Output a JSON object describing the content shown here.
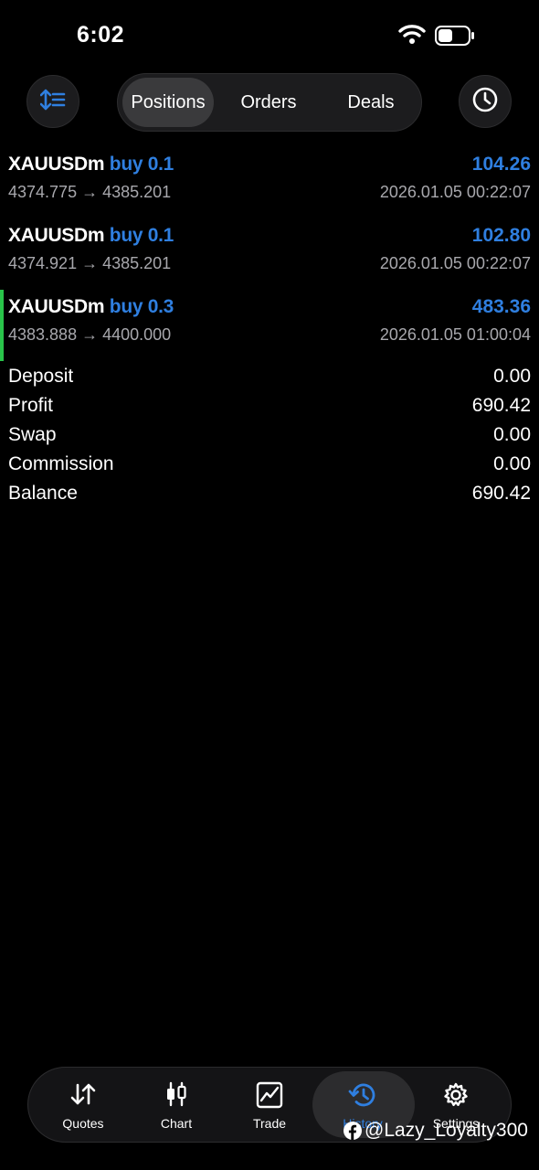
{
  "status": {
    "time": "6:02"
  },
  "tabs": [
    {
      "label": "Positions",
      "active": true
    },
    {
      "label": "Orders",
      "active": false
    },
    {
      "label": "Deals",
      "active": false
    }
  ],
  "deals": [
    {
      "symbol": "XAUUSDm",
      "side": "buy 0.1",
      "profit": "104.26",
      "prices": "4374.775 → 4385.201",
      "time": "2026.01.05 00:22:07"
    },
    {
      "symbol": "XAUUSDm",
      "side": "buy 0.1",
      "profit": "102.80",
      "prices": "4374.921 → 4385.201",
      "time": "2026.01.05 00:22:07"
    },
    {
      "symbol": "XAUUSDm",
      "side": "buy 0.3",
      "profit": "483.36",
      "prices": "4383.888 → 4400.000",
      "time": "2026.01.05 01:00:04"
    }
  ],
  "summary": [
    {
      "label": "Deposit",
      "value": "0.00"
    },
    {
      "label": "Profit",
      "value": "690.42"
    },
    {
      "label": "Swap",
      "value": "0.00"
    },
    {
      "label": "Commission",
      "value": "0.00"
    },
    {
      "label": "Balance",
      "value": "690.42"
    }
  ],
  "nav": [
    {
      "label": "Quotes",
      "icon": "quotes-arrows-icon"
    },
    {
      "label": "Chart",
      "icon": "candlestick-icon"
    },
    {
      "label": "Trade",
      "icon": "trade-chart-icon"
    },
    {
      "label": "History",
      "icon": "history-clock-icon",
      "active": true
    },
    {
      "label": "Settings",
      "icon": "gear-icon"
    }
  ],
  "watermark": "@Lazy_Loyalty300",
  "colors": {
    "accent": "#2f7fe0",
    "marker": "#29c44a",
    "background": "#000000"
  }
}
